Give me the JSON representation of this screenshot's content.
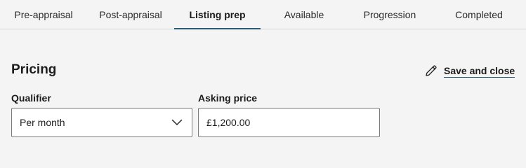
{
  "tabs": [
    {
      "label": "Pre-appraisal"
    },
    {
      "label": "Post-appraisal"
    },
    {
      "label": "Listing prep",
      "active": true
    },
    {
      "label": "Available"
    },
    {
      "label": "Progression"
    },
    {
      "label": "Completed"
    }
  ],
  "section": {
    "title": "Pricing",
    "save_close_label": "Save and close",
    "save_icon": "pencil-icon"
  },
  "fields": {
    "qualifier": {
      "label": "Qualifier",
      "value": "Per month",
      "icon": "chevron-down-icon"
    },
    "asking_price": {
      "label": "Asking price",
      "value": "£1,200.00"
    }
  },
  "colors": {
    "accent": "#2a5a7a",
    "background": "#f4f4f5",
    "input_border": "#7a7a7c"
  }
}
